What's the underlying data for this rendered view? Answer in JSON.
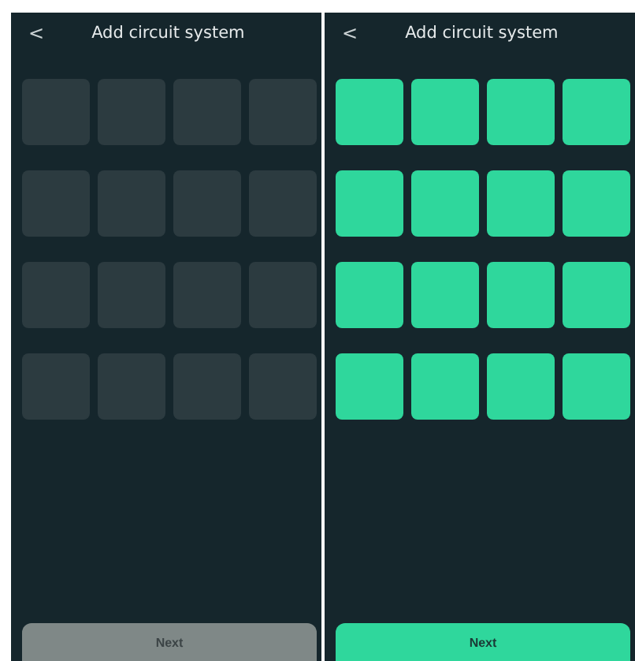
{
  "screens": [
    {
      "back": "<",
      "title": "Add circuit system",
      "cells": [
        {
          "selected": false
        },
        {
          "selected": false
        },
        {
          "selected": false
        },
        {
          "selected": false
        },
        {
          "selected": false
        },
        {
          "selected": false
        },
        {
          "selected": false
        },
        {
          "selected": false
        },
        {
          "selected": false
        },
        {
          "selected": false
        },
        {
          "selected": false
        },
        {
          "selected": false
        },
        {
          "selected": false
        },
        {
          "selected": false
        },
        {
          "selected": false
        },
        {
          "selected": false
        }
      ],
      "button": {
        "label": "Next",
        "disabled": true
      }
    },
    {
      "back": "<",
      "title": "Add circuit system",
      "cells": [
        {
          "selected": true
        },
        {
          "selected": true
        },
        {
          "selected": true
        },
        {
          "selected": true
        },
        {
          "selected": true
        },
        {
          "selected": true
        },
        {
          "selected": true
        },
        {
          "selected": true
        },
        {
          "selected": true
        },
        {
          "selected": true
        },
        {
          "selected": true
        },
        {
          "selected": true
        },
        {
          "selected": true
        },
        {
          "selected": true
        },
        {
          "selected": true
        },
        {
          "selected": true
        }
      ],
      "button": {
        "label": "Next",
        "disabled": false
      }
    }
  ]
}
